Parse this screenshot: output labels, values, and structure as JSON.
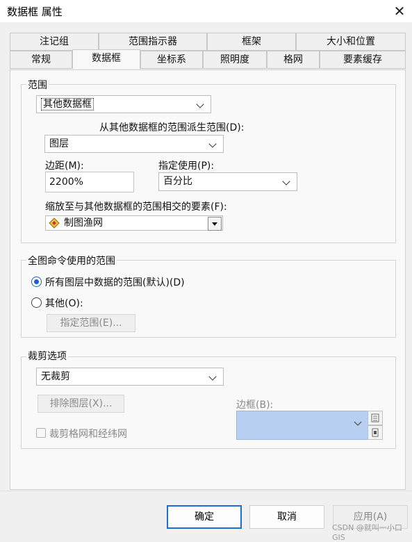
{
  "window": {
    "title": "数据框 属性",
    "close_icon": "close-icon"
  },
  "tabs_row1": [
    "注记组",
    "范围指示器",
    "框架",
    "大小和位置"
  ],
  "tabs_row2": [
    "常规",
    "数据框",
    "坐标系",
    "照明度",
    "格网",
    "要素缓存"
  ],
  "active_tab": "数据框",
  "extent": {
    "legend": "范围",
    "mode_value": "其他数据框",
    "derive_label": "从其他数据框的范围派生范围(D):",
    "derive_value": "图层",
    "margin_label": "边距(M):",
    "margin_value": "2200%",
    "specify_label": "指定使用(P):",
    "specify_value": "百分比",
    "zoom_label": "缩放至与其他数据框的范围相交的要素(F):",
    "zoom_value": "制图渔网"
  },
  "full_extent": {
    "legend": "全图命令使用的范围",
    "option_all": "所有图层中数据的范围(默认)(D)",
    "option_other": "其他(O):",
    "specify_button": "指定范围(E)..."
  },
  "clip": {
    "legend": "裁剪选项",
    "value": "无裁剪",
    "exclude_button": "排除图层(X)...",
    "border_label": "边框(B):",
    "clip_grid_label": "裁剪格网和经纬网"
  },
  "buttons": {
    "ok": "确定",
    "cancel": "取消",
    "apply": "应用(A)"
  },
  "watermark": "CSDN @就叫一小口GIS",
  "colors": {
    "accent": "#1a6fd0",
    "border_preview": "#b7cff0"
  }
}
